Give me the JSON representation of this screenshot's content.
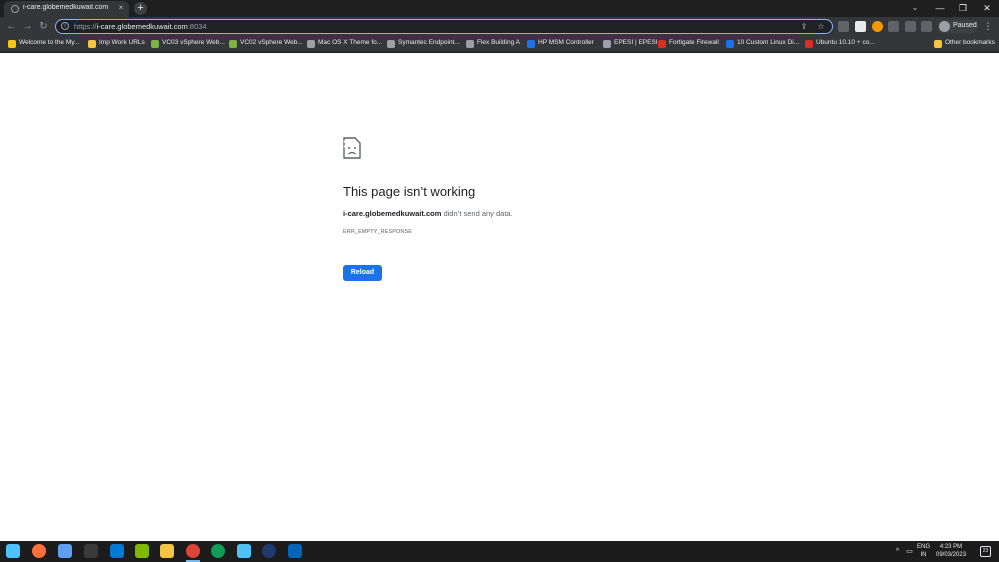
{
  "browser": {
    "tab": {
      "title": "i-care.globemedkuwait.com",
      "close_glyph": "×"
    },
    "new_tab_glyph": "+",
    "tab_search_glyph": "⌄",
    "window_controls": {
      "minimize": "—",
      "restore": "❐",
      "close": "✕"
    },
    "nav": {
      "back": "←",
      "forward": "→",
      "reload": "↻"
    },
    "omnibox": {
      "scheme": "https://",
      "host": "i-care.globemedkuwait.com",
      "port": ":8034"
    },
    "omnibox_icons": {
      "share": "⇪",
      "bookmark": "☆"
    },
    "profile": {
      "label": "Paused"
    },
    "menu_glyph": "⋮"
  },
  "bookmarks": [
    {
      "label": "Welcome to the My...",
      "icon_color": "#f9c513"
    },
    {
      "label": "Imp Work URLs",
      "icon_color": "#f4c542"
    },
    {
      "label": "VC03 vSphere Web...",
      "icon_color": "#7cb342"
    },
    {
      "label": "VC02 vSphere Web...",
      "icon_color": "#7cb342"
    },
    {
      "label": "Mac OS X Theme fo...",
      "icon_color": "#9aa0a6"
    },
    {
      "label": "Symantec Endpoint...",
      "icon_color": "#9aa0a6"
    },
    {
      "label": "Flex Building A",
      "icon_color": "#9aa0a6"
    },
    {
      "label": "HP MSM Controller",
      "icon_color": "#1a73e8"
    },
    {
      "label": "EPESI | EPESI",
      "icon_color": "#9aa0a6"
    },
    {
      "label": "Fortigate Firewall",
      "icon_color": "#d93025"
    },
    {
      "label": "10 Custom Linux Di...",
      "icon_color": "#1a73e8"
    },
    {
      "label": "Ubuntu 10.10 + co...",
      "icon_color": "#d93025"
    },
    {
      "label": "Other bookmarks",
      "icon_color": "#f4c542"
    }
  ],
  "error_page": {
    "title": "This page isn’t working",
    "host": "i-care.globemedkuwait.com",
    "message": "didn’t send any data.",
    "code": "ERR_EMPTY_RESPONSE",
    "reload_label": "Reload"
  },
  "taskbar": {
    "apps": [
      {
        "name": "start",
        "color": "#4cc2ff"
      },
      {
        "name": "firefox",
        "color": "#ff7139"
      },
      {
        "name": "people",
        "color": "#5ea0ef"
      },
      {
        "name": "terminal",
        "color": "#3a3a3a"
      },
      {
        "name": "remote-desktop",
        "color": "#0078d4"
      },
      {
        "name": "network",
        "color": "#7fba00"
      },
      {
        "name": "file-explorer",
        "color": "#f4c542"
      },
      {
        "name": "chrome",
        "color": "#db4437"
      },
      {
        "name": "edge",
        "color": "#0f9d58"
      },
      {
        "name": "notepad",
        "color": "#4fc3f7"
      },
      {
        "name": "keepass",
        "color": "#1e3a6e"
      },
      {
        "name": "outlook",
        "color": "#0364b8"
      }
    ],
    "language": {
      "line1": "ENG",
      "line2": "IN"
    },
    "clock": {
      "time": "4:23 PM",
      "date": "09/03/2023"
    },
    "notification_count": "23",
    "tray_glyphs": {
      "chevron": "^",
      "display": "▭",
      "volume": "🔈"
    }
  }
}
